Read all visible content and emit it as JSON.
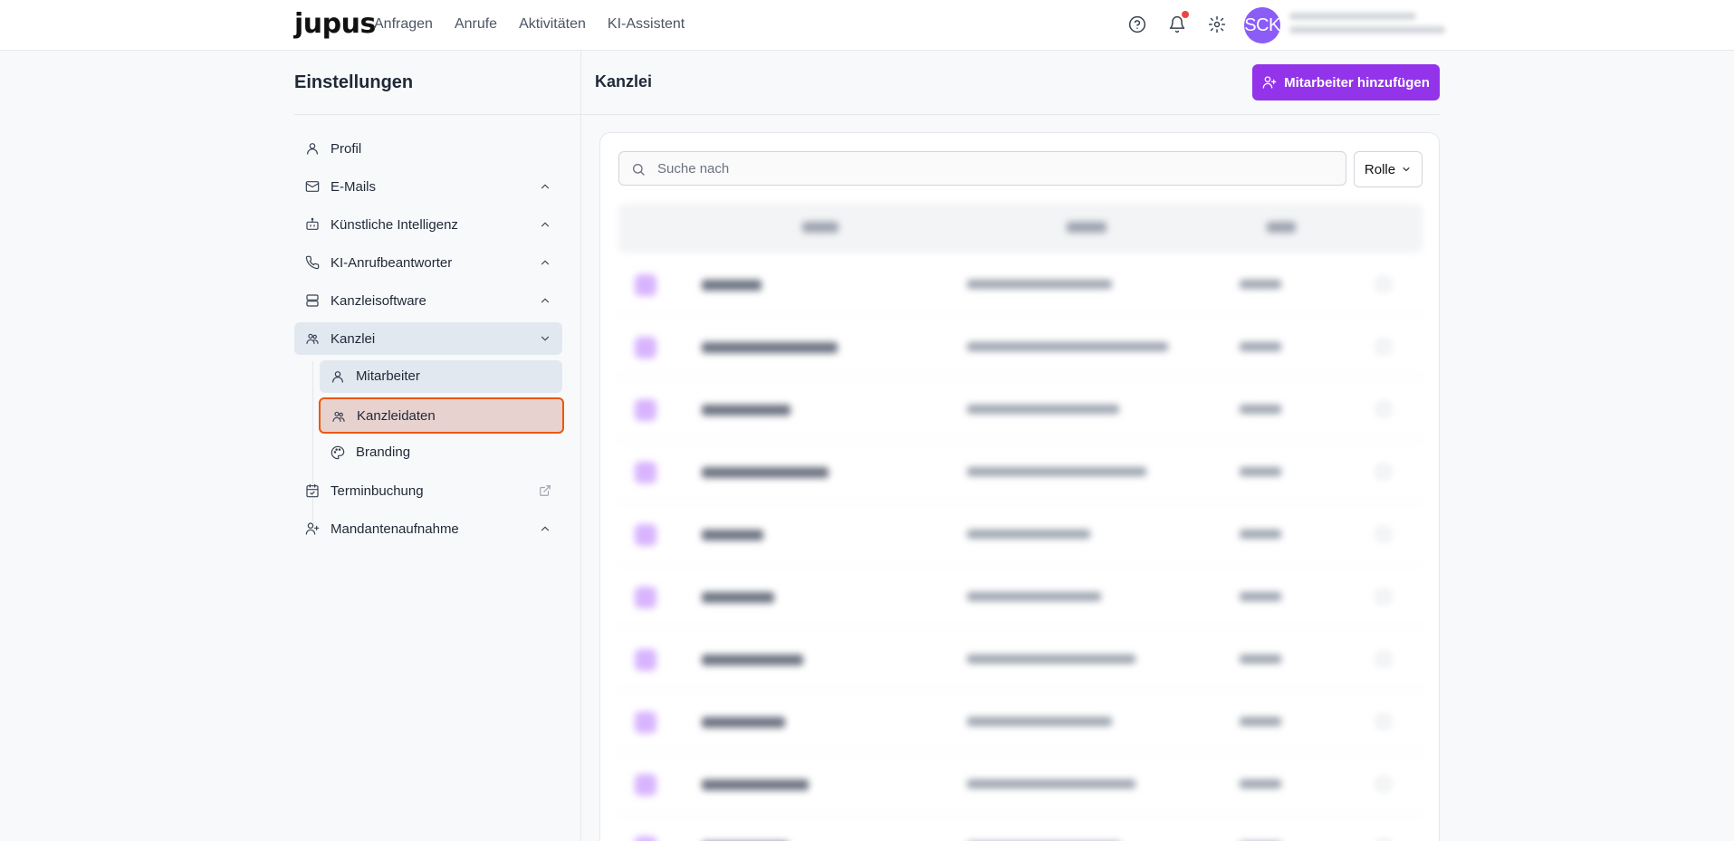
{
  "header": {
    "logo": "jupus",
    "nav": [
      "Anfragen",
      "Anrufe",
      "Aktivitäten",
      "KI-Assistent"
    ],
    "avatar_initials": "SCK",
    "icons": [
      "help-circle-icon",
      "bell-icon",
      "gear-icon"
    ]
  },
  "sidebar": {
    "title": "Einstellungen",
    "items": [
      {
        "label": "Profil",
        "icon": "user-icon"
      },
      {
        "label": "E-Mails",
        "icon": "mail-icon"
      },
      {
        "label": "Künstliche Intelligenz",
        "icon": "bot-icon"
      },
      {
        "label": "KI-Anrufbeantworter",
        "icon": "phone-icon"
      },
      {
        "label": "Kanzleisoftware",
        "icon": "server-icon"
      },
      {
        "label": "Kanzlei",
        "icon": "users-icon"
      },
      {
        "label": "Terminbuchung",
        "icon": "calendar-check-icon"
      },
      {
        "label": "Mandantenaufnahme",
        "icon": "user-plus-icon"
      }
    ],
    "subitems": [
      {
        "label": "Mitarbeiter",
        "icon": "user-icon"
      },
      {
        "label": "Kanzleidaten",
        "icon": "users-icon"
      },
      {
        "label": "Branding",
        "icon": "palette-icon"
      }
    ]
  },
  "main": {
    "title": "Kanzlei",
    "add_button": "Mitarbeiter hinzufügen",
    "search_placeholder": "Suche nach",
    "role_filter": "Rolle"
  },
  "colors": {
    "accent": "#9333ea",
    "avatar": "#8b5cf6",
    "highlight_border": "#ea580c",
    "active_bg": "#e2e8f0"
  }
}
